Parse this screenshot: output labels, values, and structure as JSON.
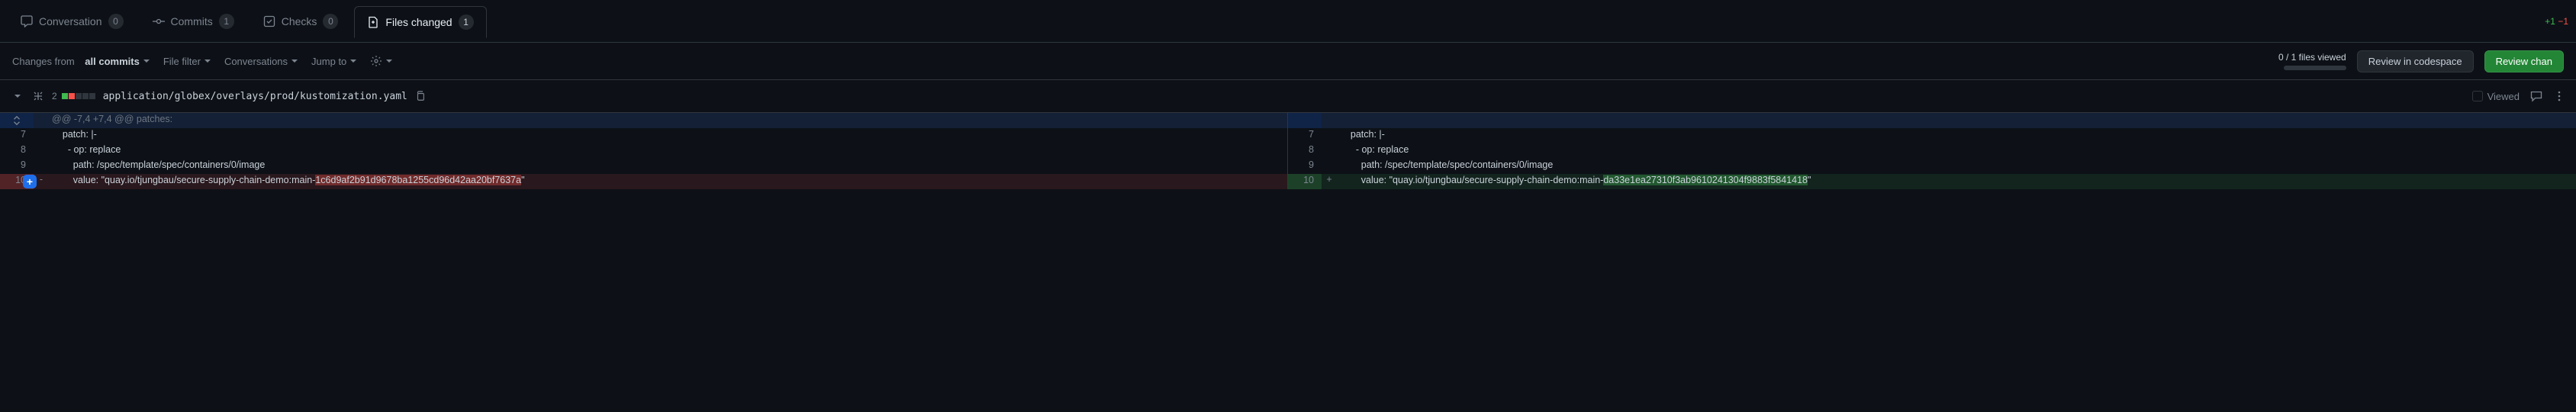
{
  "tabs": {
    "conversation": {
      "label": "Conversation",
      "count": "0"
    },
    "commits": {
      "label": "Commits",
      "count": "1"
    },
    "checks": {
      "label": "Checks",
      "count": "0"
    },
    "files": {
      "label": "Files changed",
      "count": "1"
    }
  },
  "diffstat_header": {
    "additions": "+1",
    "deletions": "−1"
  },
  "toolbar": {
    "changes_from": "Changes from",
    "all_commits": "all commits",
    "file_filter": "File filter",
    "conversations": "Conversations",
    "jump_to": "Jump to",
    "viewed_progress": "0 / 1 files viewed",
    "review_codespace": "Review in codespace",
    "review_changes": "Review chan"
  },
  "file": {
    "changes": "2",
    "path": "application/globex/overlays/prod/kustomization.yaml",
    "viewed_label": "Viewed"
  },
  "hunk": "@@ -7,4 +7,4 @@ patches:",
  "lines": {
    "l7": "7",
    "l8": "8",
    "l9": "9",
    "l10": "10",
    "patch": "    patch: |-",
    "op": "      - op: replace",
    "path": "        path: /spec/template/spec/containers/0/image",
    "del_prefix": "        value: \"quay.io/tjungbau/secure-supply-chain-demo:main-",
    "del_hash": "1c6d9af2b91d9678ba1255cd96d42aa20bf7637a",
    "del_suffix": "\"",
    "add_prefix": "        value: \"quay.io/tjungbau/secure-supply-chain-demo:main-",
    "add_hash": "da33e1ea27310f3ab9610241304f9883f5841418",
    "add_suffix": "\""
  }
}
